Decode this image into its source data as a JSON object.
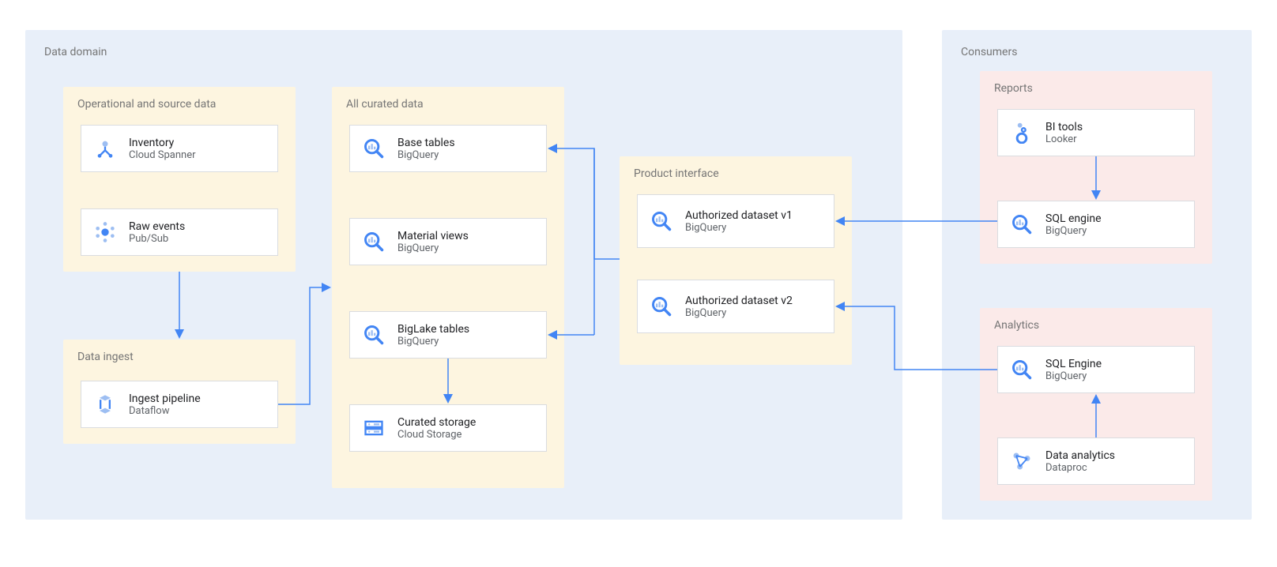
{
  "colors": {
    "lightBlueBg": "#e8eff9",
    "lightYellowBg": "#fdf5e0",
    "lightRedBg": "#fbeae9",
    "arrowBlue": "#4285f4",
    "iconBlue": "#4285f4",
    "iconLightBlue": "#9dbef2"
  },
  "regions": {
    "dataDomain": {
      "label": "Data domain"
    },
    "consumers": {
      "label": "Consumers"
    }
  },
  "groups": {
    "operational": {
      "label": "Operational and source data"
    },
    "dataIngest": {
      "label": "Data ingest"
    },
    "curated": {
      "label": "All curated data"
    },
    "productInterface": {
      "label": "Product interface"
    },
    "reports": {
      "label": "Reports"
    },
    "analytics": {
      "label": "Analytics"
    }
  },
  "cards": {
    "inventory": {
      "title": "Inventory",
      "subtitle": "Cloud Spanner"
    },
    "rawEvents": {
      "title": "Raw events",
      "subtitle": "Pub/Sub"
    },
    "ingestPipeline": {
      "title": "Ingest pipeline",
      "subtitle": "Dataflow"
    },
    "baseTables": {
      "title": "Base tables",
      "subtitle": "BigQuery"
    },
    "materialViews": {
      "title": "Material views",
      "subtitle": "BigQuery"
    },
    "biglakeTables": {
      "title": "BigLake tables",
      "subtitle": "BigQuery"
    },
    "curatedStorage": {
      "title": "Curated storage",
      "subtitle": "Cloud Storage"
    },
    "authV1": {
      "title": "Authorized dataset v1",
      "subtitle": "BigQuery"
    },
    "authV2": {
      "title": "Authorized dataset v2",
      "subtitle": "BigQuery"
    },
    "biTools": {
      "title": "BI tools",
      "subtitle": "Looker"
    },
    "sqlEngineReports": {
      "title": "SQL engine",
      "subtitle": "BigQuery"
    },
    "sqlEngineAnalytics": {
      "title": "SQL Engine",
      "subtitle": "BigQuery"
    },
    "dataAnalytics": {
      "title": "Data analytics",
      "subtitle": "Dataproc"
    }
  }
}
